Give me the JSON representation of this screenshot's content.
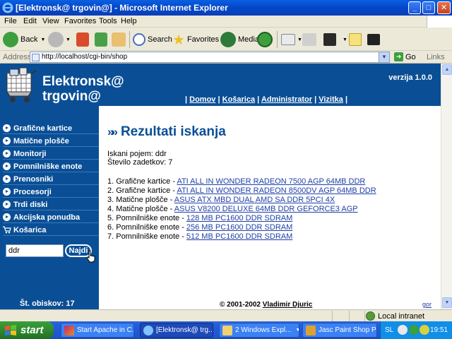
{
  "window": {
    "title": "[Elektronsk@ trgovin@] - Microsoft Internet Explorer",
    "controls": {
      "minimize": "_",
      "maximize": "□",
      "close": "✕"
    }
  },
  "menu": [
    "File",
    "Edit",
    "View",
    "Favorites",
    "Tools",
    "Help"
  ],
  "toolbar": {
    "back": "Back",
    "search": "Search",
    "favorites": "Favorites",
    "media": "Media"
  },
  "address": {
    "label": "Address",
    "url": "http://localhost/cgi-bin/shop",
    "go": "Go",
    "links": "Links"
  },
  "site": {
    "brand_line1": "Elektronsk@",
    "brand_line2": "trgovin@",
    "version": "verzija 1.0.0",
    "nav": [
      "Domov",
      "Košarica",
      "Administrator",
      "Vizitka"
    ],
    "nav_separator": "|",
    "sidebar": [
      "Grafične kartice",
      "Matične plošče",
      "Monitorji",
      "Pomnilniške enote",
      "Prenosniki",
      "Procesorji",
      "Trdi diski",
      "Akcijska ponudba"
    ],
    "cart_label": "Košarica",
    "search_value": "ddr",
    "search_button": "Najdi",
    "visits": "Št. obiskov: 17"
  },
  "results": {
    "chevrons": "»",
    "title": "Rezultati iskanja",
    "query_line": "Iskani pojem: ddr",
    "count_line": "Število zadetkov: 7",
    "items": [
      {
        "prefix": "1. Grafične kartice - ",
        "link": "ATI ALL IN WONDER RADEON 7500 AGP 64MB DDR"
      },
      {
        "prefix": "2. Grafične kartice - ",
        "link": "ATI ALL IN WONDER RADEON 8500DV AGP 64MB DDR"
      },
      {
        "prefix": "3. Matične plošče - ",
        "link": "ASUS ATX MBD DUAL AMD SA DDR 5PCI 4X"
      },
      {
        "prefix": "4. Matične plošče - ",
        "link": "ASUS V8200 DELUXE 64MB DDR GEFORCE3 AGP"
      },
      {
        "prefix": "5. Pomnilniške enote - ",
        "link": "128 MB PC1600 DDR SDRAM"
      },
      {
        "prefix": "6. Pomnilniške enote - ",
        "link": "256 MB PC1600 DDR SDRAM"
      },
      {
        "prefix": "7. Pomnilniške enote - ",
        "link": "512 MB PC1600 DDR SDRAM"
      }
    ]
  },
  "footer": {
    "copyright": "© 2001-2002 ",
    "author": "Vladimir Djuric",
    "top_link": "gor"
  },
  "statusbar": {
    "zone": "Local intranet"
  },
  "taskbar": {
    "start": "start",
    "tasks": [
      "Start Apache in C...",
      "[Elektronsk@ trg...",
      "2 Windows Expl...",
      "Jasc Paint Shop Pro"
    ],
    "lang": "SL",
    "clock": "19:51"
  },
  "icons": {
    "title": "ie-logo-icon",
    "cart": "shopping-cart-icon",
    "bullet": "arrow-bullet-icon",
    "cursor": "hand-pointer-icon"
  },
  "colors": {
    "site_blue": "#0a4f96",
    "link_blue": "#1f3fa5",
    "titlebar": "#0a5fe0",
    "taskbar": "#245edb",
    "start_green": "#2e8a2e"
  }
}
